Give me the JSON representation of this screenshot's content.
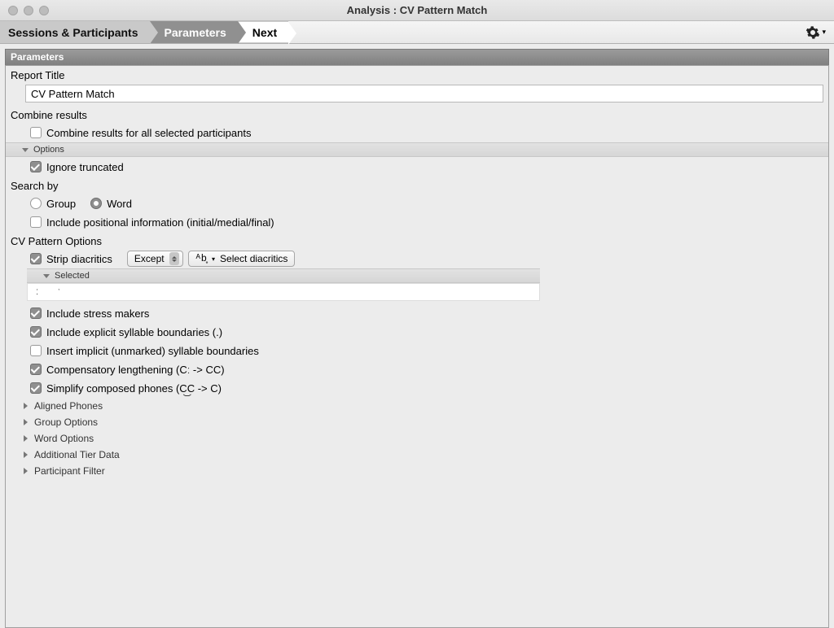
{
  "window": {
    "title": "Analysis : CV Pattern Match"
  },
  "breadcrumb": {
    "sessions": "Sessions & Participants",
    "parameters": "Parameters",
    "next": "Next"
  },
  "panel_header": "Parameters",
  "report_title": {
    "label": "Report Title",
    "value": "CV Pattern Match"
  },
  "combine": {
    "label": "Combine results",
    "combine_all": "Combine results for all selected participants",
    "options_header": "Options",
    "ignore_truncated": "Ignore truncated"
  },
  "search_by": {
    "label": "Search by",
    "group": "Group",
    "word": "Word",
    "include_positional": "Include positional information (initial/medial/final)"
  },
  "cv_options": {
    "label": "CV Pattern Options",
    "strip_diacritics": "Strip diacritics",
    "except_btn": "Except",
    "select_diacritics_btn": "Select diacritics",
    "selected_header": "Selected",
    "selected_value": "ː ˑ",
    "include_stress": "Include stress makers",
    "include_explicit": "Include explicit syllable boundaries (.)",
    "insert_implicit": "Insert implicit (unmarked) syllable boundaries",
    "compensatory": "Compensatory lengthening (Cː -> CC)",
    "simplify": "Simplify composed phones (C͜C -> C)"
  },
  "collapsed": {
    "aligned_phones": "Aligned Phones",
    "group_options": "Group Options",
    "word_options": "Word Options",
    "additional_tier": "Additional Tier Data",
    "participant_filter": "Participant Filter"
  }
}
